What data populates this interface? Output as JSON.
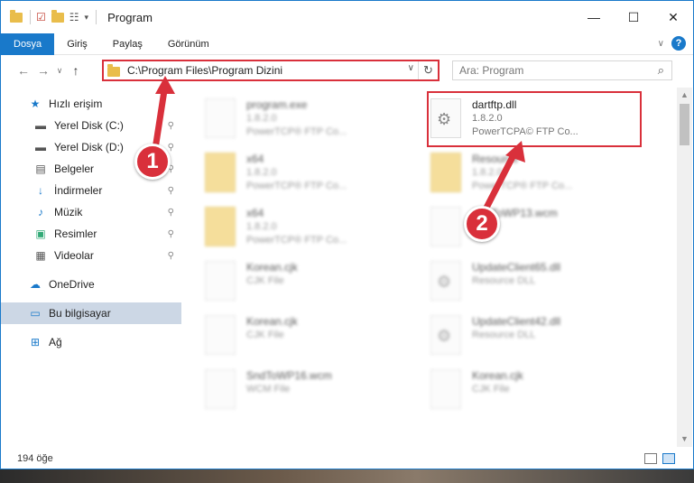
{
  "window": {
    "title": "Program",
    "controls": {
      "minimize": "—",
      "maximize": "☐",
      "close": "✕"
    }
  },
  "ribbon": {
    "tabs": [
      {
        "label": "Dosya",
        "active": true
      },
      {
        "label": "Giriş"
      },
      {
        "label": "Paylaş"
      },
      {
        "label": "Görünüm"
      }
    ],
    "expand_glyph": "∨",
    "help_glyph": "?"
  },
  "nav": {
    "back": "←",
    "forward": "→",
    "recent": "∨",
    "up": "↑",
    "address_path": "C:\\Program Files\\Program Dizini",
    "address_dropdown": "∨",
    "refresh": "↻",
    "search_placeholder": "Ara: Program",
    "search_icon_glyph": "⌕"
  },
  "sidebar": {
    "items": [
      {
        "label": "Hızlı erişim",
        "icon": "★",
        "color": "#1979ca",
        "pinned": false
      },
      {
        "label": "Yerel Disk (C:)",
        "icon": "▬",
        "color": "#555",
        "pinned": true
      },
      {
        "label": "Yerel Disk (D:)",
        "icon": "▬",
        "color": "#555",
        "pinned": true
      },
      {
        "label": "Belgeler",
        "icon": "▤",
        "color": "#555",
        "pinned": true
      },
      {
        "label": "İndirmeler",
        "icon": "↓",
        "color": "#1979ca",
        "pinned": true
      },
      {
        "label": "Müzik",
        "icon": "♪",
        "color": "#1979ca",
        "pinned": true
      },
      {
        "label": "Resimler",
        "icon": "▣",
        "color": "#3a7",
        "pinned": true
      },
      {
        "label": "Videolar",
        "icon": "▦",
        "color": "#555",
        "pinned": true
      },
      {
        "label": "OneDrive",
        "icon": "☁",
        "color": "#1979ca",
        "pinned": false
      },
      {
        "label": "Bu bilgisayar",
        "icon": "▭",
        "color": "#1979ca",
        "pinned": false,
        "selected": true
      },
      {
        "label": "Ağ",
        "icon": "⊞",
        "color": "#1979ca",
        "pinned": false
      }
    ],
    "pin_glyph": "📌"
  },
  "files": [
    {
      "name": "program.exe",
      "line1": "1.8.2.0",
      "line2": "PowerTCP® FTP Co...",
      "kind": "exe",
      "blurred": true
    },
    {
      "name": "dartftp.dll",
      "line1": "1.8.2.0",
      "line2": "PowerTCPA© FTP Co...",
      "kind": "dll",
      "blurred": false
    },
    {
      "name": "x64",
      "line1": "1.8.2.0",
      "line2": "PowerTCP® FTP Co...",
      "kind": "folder",
      "blurred": true
    },
    {
      "name": "Resource",
      "line1": "1.8.2.0",
      "line2": "PowerTCP® FTP Co...",
      "kind": "folder",
      "blurred": true
    },
    {
      "name": "x64",
      "line1": "1.8.2.0",
      "line2": "PowerTCP® FTP Co...",
      "kind": "folder",
      "blurred": true
    },
    {
      "name": "SndToWP13.wcm",
      "line1": "",
      "line2": "",
      "kind": "file",
      "blurred": true
    },
    {
      "name": "Korean.cjk",
      "line1": "CJK File",
      "line2": "",
      "kind": "file",
      "blurred": true
    },
    {
      "name": "UpdateClient65.dll",
      "line1": "Resource DLL",
      "line2": "",
      "kind": "dll",
      "blurred": true
    },
    {
      "name": "Korean.cjk",
      "line1": "CJK File",
      "line2": "",
      "kind": "file",
      "blurred": true
    },
    {
      "name": "UpdateClient42.dll",
      "line1": "Resource DLL",
      "line2": "",
      "kind": "dll",
      "blurred": true
    },
    {
      "name": "SndToWP16.wcm",
      "line1": "WCM File",
      "line2": "",
      "kind": "file",
      "blurred": true
    },
    {
      "name": "Korean.cjk",
      "line1": "CJK File",
      "line2": "",
      "kind": "file",
      "blurred": true
    }
  ],
  "status": {
    "count": "194 öğe"
  },
  "annotations": {
    "step1": "1",
    "step2": "2",
    "color": "#d9303b"
  },
  "scroll": {
    "up": "▲",
    "down": "▼"
  }
}
